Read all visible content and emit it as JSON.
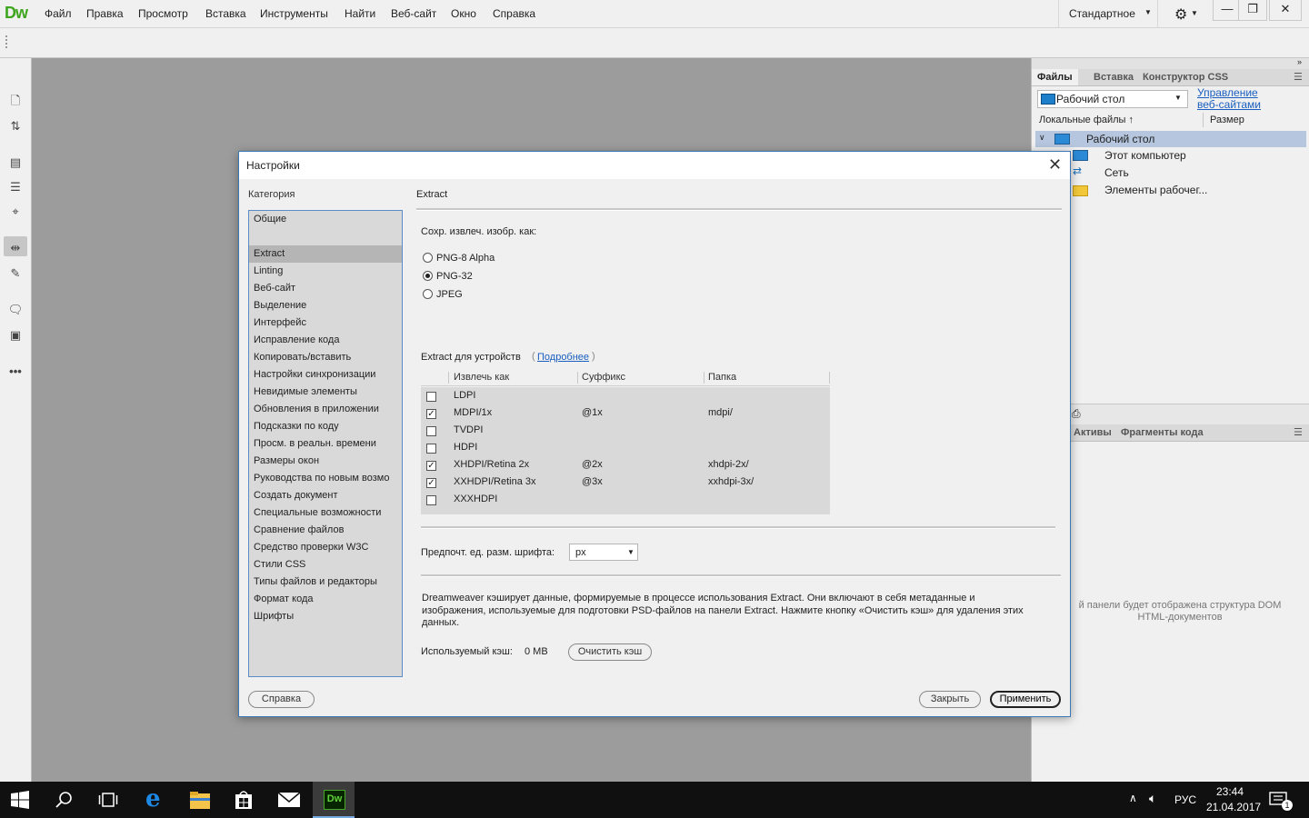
{
  "app": {
    "logo": "Dw",
    "menu": [
      "Файл",
      "Правка",
      "Просмотр",
      "Вставка",
      "Инструменты",
      "Найти",
      "Веб-сайт",
      "Окно",
      "Справка"
    ],
    "workspace": "Стандартное",
    "window_buttons": [
      "—",
      "❐",
      "✕"
    ]
  },
  "right_panel": {
    "tabs": [
      "Файлы",
      "Вставка",
      "Конструктор CSS"
    ],
    "site_select": "Рабочий стол",
    "manage_link_line1": "Управление",
    "manage_link_line2": "веб-сайтами",
    "col_local": "Локальные файлы ↑",
    "col_size": "Размер",
    "tree": [
      "Рабочий стол",
      "Этот компьютер",
      "Сеть",
      "Элементы рабочег..."
    ],
    "lower_tabs": [
      "Активы",
      "Фрагменты кода"
    ],
    "dom_message_line1": "й панели будет отображена структура DOM",
    "dom_message_line2": "HTML-документов"
  },
  "dialog": {
    "title": "Настройки",
    "category_label": "Категория",
    "categories": [
      "Общие",
      "",
      "Extract",
      "Linting",
      "Веб-сайт",
      "Выделение",
      "Интерфейс",
      "Исправление кода",
      "Копировать/вставить",
      "Настройки синхронизации",
      "Невидимые элементы",
      "Обновления в приложении",
      "Подсказки по коду",
      "Просм. в реальн. времени",
      "Размеры окон",
      "Руководства по новым возмо",
      "Создать документ",
      "Специальные возможности",
      "Сравнение файлов",
      "Средство проверки W3C",
      "Стили CSS",
      "Типы файлов и редакторы",
      "Формат кода",
      "Шрифты"
    ],
    "selected_category": "Extract",
    "section_title": "Extract",
    "save_as_label": "Сохр. извлеч. изобр. как:",
    "formats": [
      {
        "label": "PNG-8 Alpha",
        "selected": false
      },
      {
        "label": "PNG-32",
        "selected": true
      },
      {
        "label": "JPEG",
        "selected": false
      }
    ],
    "devices_label": "Extract для устройств",
    "more_link": "Подробнее",
    "columns": [
      "Извлечь как",
      "Суффикс",
      "Папка"
    ],
    "devices": [
      {
        "name": "LDPI",
        "checked": false,
        "suffix": "",
        "folder": ""
      },
      {
        "name": "MDPI/1x",
        "checked": true,
        "suffix": "@1x",
        "folder": "mdpi/"
      },
      {
        "name": "TVDPI",
        "checked": false,
        "suffix": "",
        "folder": ""
      },
      {
        "name": "HDPI",
        "checked": false,
        "suffix": "",
        "folder": ""
      },
      {
        "name": "XHDPI/Retina 2x",
        "checked": true,
        "suffix": "@2x",
        "folder": "xhdpi-2x/"
      },
      {
        "name": "XXHDPI/Retina 3x",
        "checked": true,
        "suffix": "@3x",
        "folder": "xxhdpi-3x/"
      },
      {
        "name": "XXXHDPI",
        "checked": false,
        "suffix": "",
        "folder": ""
      }
    ],
    "font_unit_label": "Предпочт. ед. разм. шрифта:",
    "font_unit_value": "px",
    "cache_desc_line1": "Dreamweaver кэширует данные, формируемые в процессе использования Extract. Они включают в себя метаданные и",
    "cache_desc_line2": "изображения, используемые для подготовки PSD-файлов на панели Extract. Нажмите кнопку «Очистить кэш» для удаления этих",
    "cache_desc_line3": "данных.",
    "cache_label": "Используемый кэш:",
    "cache_value": "0 MB",
    "clear_cache": "Очистить кэш",
    "help": "Справка",
    "close": "Закрыть",
    "apply": "Применить"
  },
  "taskbar": {
    "dw_label": "Dw",
    "language": "РУС",
    "time": "23:44",
    "date": "21.04.2017",
    "notification_count": "1"
  }
}
